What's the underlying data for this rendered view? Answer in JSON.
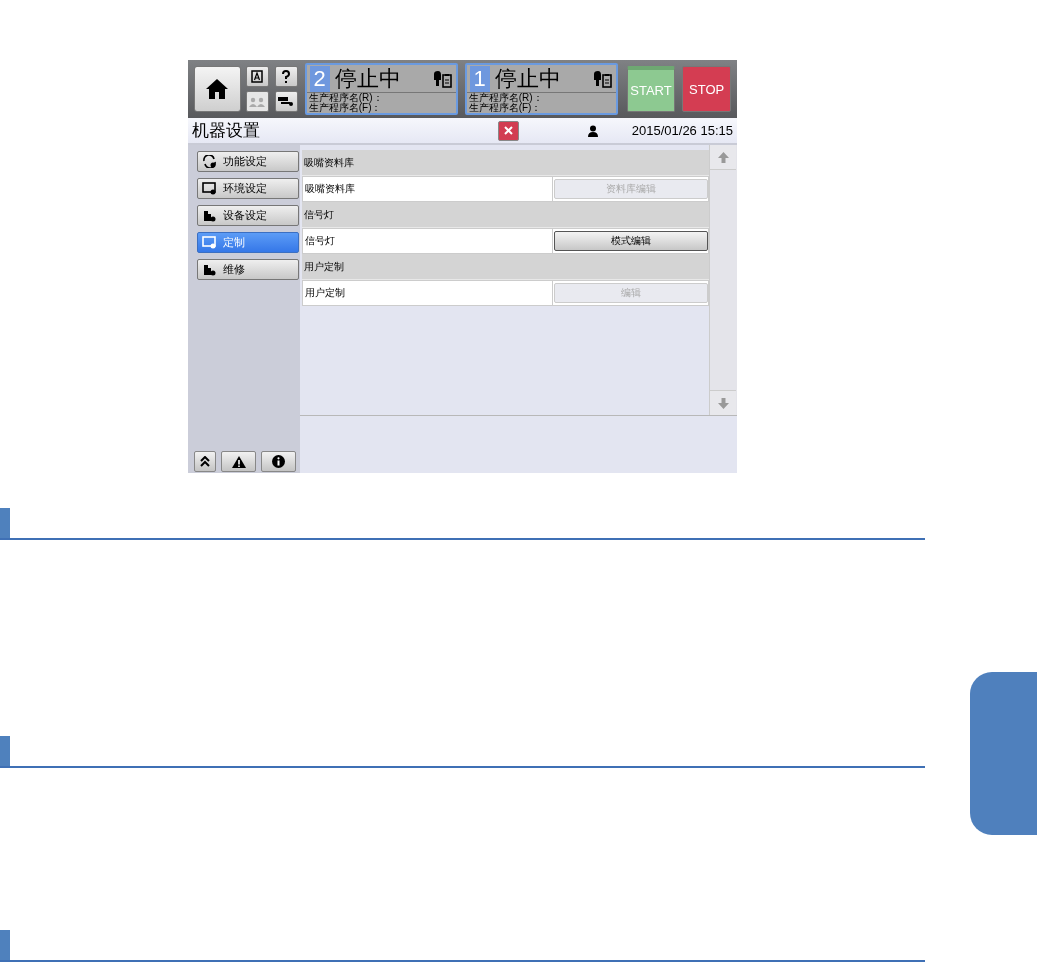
{
  "header": {
    "stations": [
      {
        "number": "2",
        "status": "停止中",
        "program_r": "生产程序名(R)：",
        "program_f": "生产程序名(F)："
      },
      {
        "number": "1",
        "status": "停止中",
        "program_r": "生产程序名(R)：",
        "program_f": "生产程序名(F)："
      }
    ],
    "start": "START",
    "stop": "STOP"
  },
  "title": "机器设置",
  "datetime": "2015/01/26 15:15",
  "sidebar": {
    "items": [
      {
        "label": "功能设定",
        "selected": false
      },
      {
        "label": "环境设定",
        "selected": false
      },
      {
        "label": "设备设定",
        "selected": false
      },
      {
        "label": "定制",
        "selected": true
      },
      {
        "label": "维修",
        "selected": false
      }
    ]
  },
  "sections": [
    {
      "header": "吸嘴资料库",
      "row_label": "吸嘴资料库",
      "button": "资料库编辑",
      "disabled": true
    },
    {
      "header": "信号灯",
      "row_label": "信号灯",
      "button": "模式编辑",
      "disabled": false
    },
    {
      "header": "用户定制",
      "row_label": "用户定制",
      "button": "编辑",
      "disabled": true
    }
  ]
}
